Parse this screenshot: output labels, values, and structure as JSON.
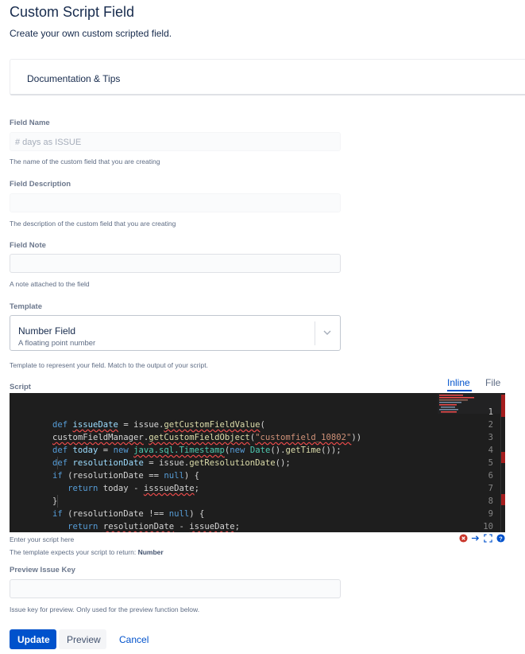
{
  "header": {
    "title": "Custom Script Field",
    "subtitle": "Create your own custom scripted field."
  },
  "documentation": {
    "title": "Documentation & Tips"
  },
  "fields": {
    "field_name": {
      "label": "Field Name",
      "value": "# days as ISSUE",
      "help": "The name of the custom field that you are creating"
    },
    "field_description": {
      "label": "Field Description",
      "value": "",
      "help": "The description of the custom field that you are creating"
    },
    "field_note": {
      "label": "Field Note",
      "value": "",
      "help": "A note attached to the field"
    },
    "template": {
      "label": "Template",
      "selected_name": "Number Field",
      "selected_description": "A floating point number",
      "help": "Template to represent your field. Match to the output of your script."
    },
    "script": {
      "label": "Script",
      "tabs": [
        "Inline",
        "File"
      ],
      "active_tab": "Inline",
      "help": "Enter your script here",
      "return_prefix": "The template expects your script to return: ",
      "return_type": "Number",
      "lines": [
        "1",
        "2",
        "3",
        "4",
        "5",
        "6",
        "7",
        "8",
        "9",
        "10"
      ],
      "editor_icons": [
        "error-icon",
        "arrow-right-icon",
        "fullscreen-icon",
        "help-icon"
      ],
      "colors": {
        "background": "#1e1e1e",
        "keyword": "#569cd6",
        "string": "#ce9178",
        "error_underline": "#f14c4c"
      }
    },
    "preview_issue_key": {
      "label": "Preview Issue Key",
      "value": "",
      "help": "Issue key for preview. Only used for the preview function below."
    }
  },
  "actions": {
    "update_label": "Update",
    "preview_label": "Preview",
    "cancel_label": "Cancel"
  },
  "colors": {
    "primary": "#0052cc",
    "text": "#172b4d",
    "muted": "#6b778c"
  }
}
